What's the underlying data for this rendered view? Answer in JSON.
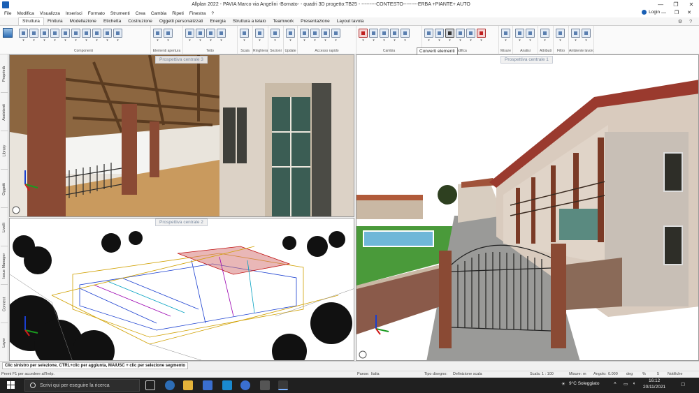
{
  "window": {
    "title": "Allplan 2022 - PAVIA Marco via Angelini -Bornato- - quadri 3D progetto:TB25 - ---------CONTESTO---------ERBA +PIANTE+ AUTO",
    "controls": [
      "—",
      "❐",
      "✕"
    ]
  },
  "menubar": {
    "items": [
      "File",
      "Modifica",
      "Visualizza",
      "Inserisci",
      "Formato",
      "Strumenti",
      "Crea",
      "Cambia",
      "Ripeti",
      "Finestra",
      "?"
    ],
    "login_label": "Login",
    "mini_controls": "— ❐ ✕"
  },
  "ribbon_tabs": {
    "items": [
      "Struttura",
      "Finitura",
      "Modellazione",
      "Etichetta",
      "Costruzione",
      "Oggetti personalizzati",
      "Energia",
      "Struttura a telaio",
      "Teamwork",
      "Presentazione",
      "Layout tavola"
    ],
    "active_index": 0,
    "right_controls": "⚙ ?"
  },
  "ribbon_groups": [
    {
      "label": "Componenti",
      "icons": 10
    },
    {
      "label": "Elementi apertura",
      "icons": 2
    },
    {
      "label": "Tetto",
      "icons": 4
    },
    {
      "label": "Scala",
      "icons": 1
    },
    {
      "label": "Ringhiera",
      "icons": 1
    },
    {
      "label": "Sezioni",
      "icons": 1
    },
    {
      "label": "Update",
      "icons": 1
    },
    {
      "label": "Accesso rapido",
      "icons": 4
    },
    {
      "label": "Cambia",
      "icons": 5
    },
    {
      "label": "Modifica",
      "icons": 6
    },
    {
      "label": "Misure",
      "icons": 1
    },
    {
      "label": "Analisi",
      "icons": 2
    },
    {
      "label": "Attributi",
      "icons": 1
    },
    {
      "label": "Filtro",
      "icons": 1
    },
    {
      "label": "Ambiente lavoro",
      "icons": 2
    }
  ],
  "tooltip": "Converti elementi",
  "side_tabs": [
    "Proprietà",
    "Assistenti",
    "Library",
    "Oggetti",
    "Livelli",
    "Issue Manager",
    "Connect",
    "Layer"
  ],
  "viewports": {
    "top_left": {
      "label": "Prospettiva centrale 3"
    },
    "bottom_left": {
      "label": "Prospettiva centrale 2"
    },
    "right": {
      "label": "Prospettiva centrale 1"
    }
  },
  "status": {
    "prompt": "Clic sinistro per selezione, CTRL+clic per aggiunta, MAIUSC + clic per selezione segmento"
  },
  "infobar": {
    "help": "Premi F1 per accedere all'help.",
    "paese_label": "Paese:",
    "paese_value": "Italia",
    "tipo_label": "Tipo disegno:",
    "tipo_value": "Definizione scala",
    "scala_label": "Scala:",
    "scala_value": "1 : 100",
    "misure_label": "Misure:",
    "misure_value": "m",
    "angolo_label": "Angolo:",
    "angolo_value": "0.000",
    "deg_label": "deg",
    "percent": "%",
    "percent_value": "5",
    "notifiche": "Notifiche"
  },
  "taskbar": {
    "search_placeholder": "Scrivi qui per eseguire la ricerca",
    "weather": "9°C Soleggiato",
    "time": "16:12",
    "date": "20/11/2021"
  }
}
